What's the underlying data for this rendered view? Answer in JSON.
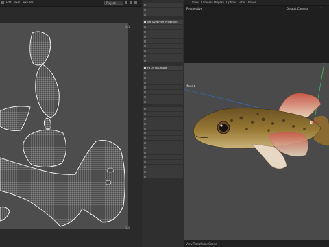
{
  "uv_editor": {
    "menu": [
      "Edit",
      "Pixel",
      "Textures"
    ],
    "mode_select": "Project",
    "corner_top": "1,1",
    "corner_bottom": "1,0"
  },
  "command_panel": {
    "items": [
      {
        "label": "",
        "active": false
      },
      {
        "label": "",
        "active": false
      },
      {
        "label": "",
        "active": false
      },
      {
        "label": "Set UVW From Projection",
        "active": true
      },
      {
        "label": "",
        "active": false
      },
      {
        "label": "",
        "active": false
      },
      {
        "label": "",
        "active": false
      },
      {
        "label": "",
        "active": false
      },
      {
        "label": "",
        "active": false
      },
      {
        "label": "",
        "active": false
      },
      {
        "label": "",
        "active": false
      },
      {
        "label": "",
        "active": false
      },
      {
        "label": "Fit UV to Canvas",
        "active": true
      },
      {
        "label": "",
        "active": false
      },
      {
        "label": "",
        "active": false
      },
      {
        "label": "",
        "active": false
      },
      {
        "label": "",
        "active": false
      },
      {
        "label": "",
        "active": false
      },
      {
        "label": "",
        "active": false
      },
      {
        "label": "",
        "active": false
      },
      {
        "label": "",
        "active": false
      },
      {
        "label": "",
        "active": false
      },
      {
        "label": "",
        "active": false
      },
      {
        "label": "",
        "active": false
      },
      {
        "label": "",
        "active": false
      },
      {
        "label": "",
        "active": false
      },
      {
        "label": "",
        "active": false
      },
      {
        "label": "",
        "active": false
      },
      {
        "label": "",
        "active": false
      },
      {
        "label": "",
        "active": false
      },
      {
        "label": "",
        "active": false
      },
      {
        "label": "",
        "active": false
      },
      {
        "label": "",
        "active": false
      },
      {
        "label": "",
        "active": false
      },
      {
        "label": "",
        "active": false
      }
    ]
  },
  "viewport": {
    "menu": [
      "View",
      "Cameras",
      "Display",
      "Options",
      "Filter",
      "Panel"
    ],
    "view_name": "Perspective",
    "camera_name": "Default Camera",
    "tool_label": "Move",
    "footer": "View Transform: Scene"
  },
  "colors": {
    "uv_background": "#4d4d4d",
    "uv_mesh": "#e6e6e6",
    "viewport_scene": "#4a4a4a",
    "fish_body": "#8a6a30",
    "axis_x": "#d03030",
    "axis_y": "#30c050",
    "axis_z": "#3070d0"
  }
}
